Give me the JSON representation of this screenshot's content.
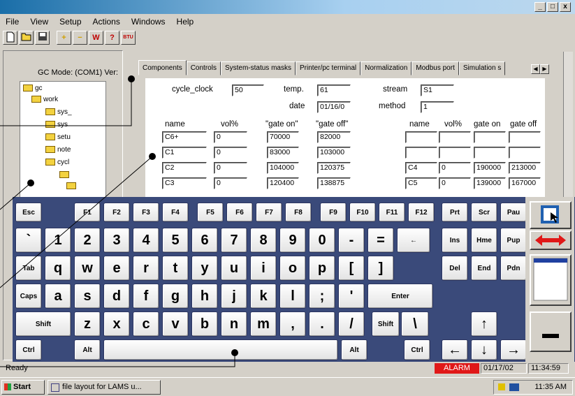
{
  "window": {
    "minimize": "_",
    "maximize": "□",
    "close": "x"
  },
  "menu": [
    "File",
    "View",
    "Setup",
    "Actions",
    "Windows",
    "Help"
  ],
  "toolbar": {
    "icons": [
      "new-icon",
      "open-icon",
      "save-icon",
      "plus-icon",
      "minus-icon",
      "w-icon",
      "help-icon",
      "btu-icon"
    ],
    "w_label": "W",
    "help_label": "?",
    "btu_label": "BTU",
    "plus_label": "+",
    "minus_label": "−"
  },
  "left": {
    "gc_mode": "GC Mode: (COM1) Ver:",
    "tree": [
      "gc",
      "work",
      "sys_",
      "sys",
      "setu",
      "note",
      "cycl"
    ]
  },
  "tabs": [
    "Components",
    "Controls",
    "System-status masks",
    "Printer/pc terminal",
    "Normalization",
    "Modbus port",
    "Simulation s"
  ],
  "form": {
    "cycle_clock_label": "cycle_clock",
    "cycle_clock": "50",
    "temp_label": "temp.",
    "temp": "61",
    "stream_label": "stream",
    "stream": "S1",
    "date_label": "date",
    "date": "01/16/0",
    "method_label": "method",
    "method": "1",
    "headers_left": [
      "name",
      "vol%",
      "\"gate on\"",
      "\"gate off\""
    ],
    "headers_right": [
      "name",
      "vol%",
      "gate on",
      "gate off"
    ],
    "rows_left": [
      [
        "C6+",
        "0",
        "70000",
        "82000"
      ],
      [
        "C1",
        "0",
        "83000",
        "103000"
      ],
      [
        "C2",
        "0",
        "104000",
        "120375"
      ],
      [
        "C3",
        "0",
        "120400",
        "138875"
      ]
    ],
    "rows_right": [
      [
        "",
        "",
        "",
        ""
      ],
      [
        "",
        "",
        "",
        ""
      ],
      [
        "C4",
        "0",
        "190000",
        "213000"
      ],
      [
        "C5",
        "0",
        "139000",
        "167000"
      ]
    ]
  },
  "keyboard": {
    "row0": [
      "Esc",
      "F1",
      "F2",
      "F3",
      "F4",
      "F5",
      "F6",
      "F7",
      "F8",
      "F9",
      "F10",
      "F11",
      "F12",
      "Prt",
      "Scr",
      "Pau"
    ],
    "row1": [
      "`",
      "1",
      "2",
      "3",
      "4",
      "5",
      "6",
      "7",
      "8",
      "9",
      "0",
      "-",
      "=",
      "←",
      "Ins",
      "Hme",
      "Pup"
    ],
    "row2": [
      "Tab",
      "q",
      "w",
      "e",
      "r",
      "t",
      "y",
      "u",
      "i",
      "o",
      "p",
      "[",
      "]",
      "Del",
      "End",
      "Pdn"
    ],
    "row3": [
      "Caps",
      "a",
      "s",
      "d",
      "f",
      "g",
      "h",
      "j",
      "k",
      "l",
      ";",
      "'",
      "Enter"
    ],
    "row4": [
      "Shift",
      "z",
      "x",
      "c",
      "v",
      "b",
      "n",
      "m",
      ",",
      ".",
      "/",
      "Shift",
      "\\",
      "↑"
    ],
    "row5": [
      "Ctrl",
      "Alt",
      "Alt",
      "Ctrl",
      "←",
      "↓",
      "→"
    ]
  },
  "status": {
    "ready": "Ready",
    "alarm": "ALARM",
    "date": "01/17/02",
    "time": "11:34:59"
  },
  "taskbar": {
    "start": "Start",
    "item": "file layout for LAMS u...",
    "clock": "11:35 AM"
  }
}
